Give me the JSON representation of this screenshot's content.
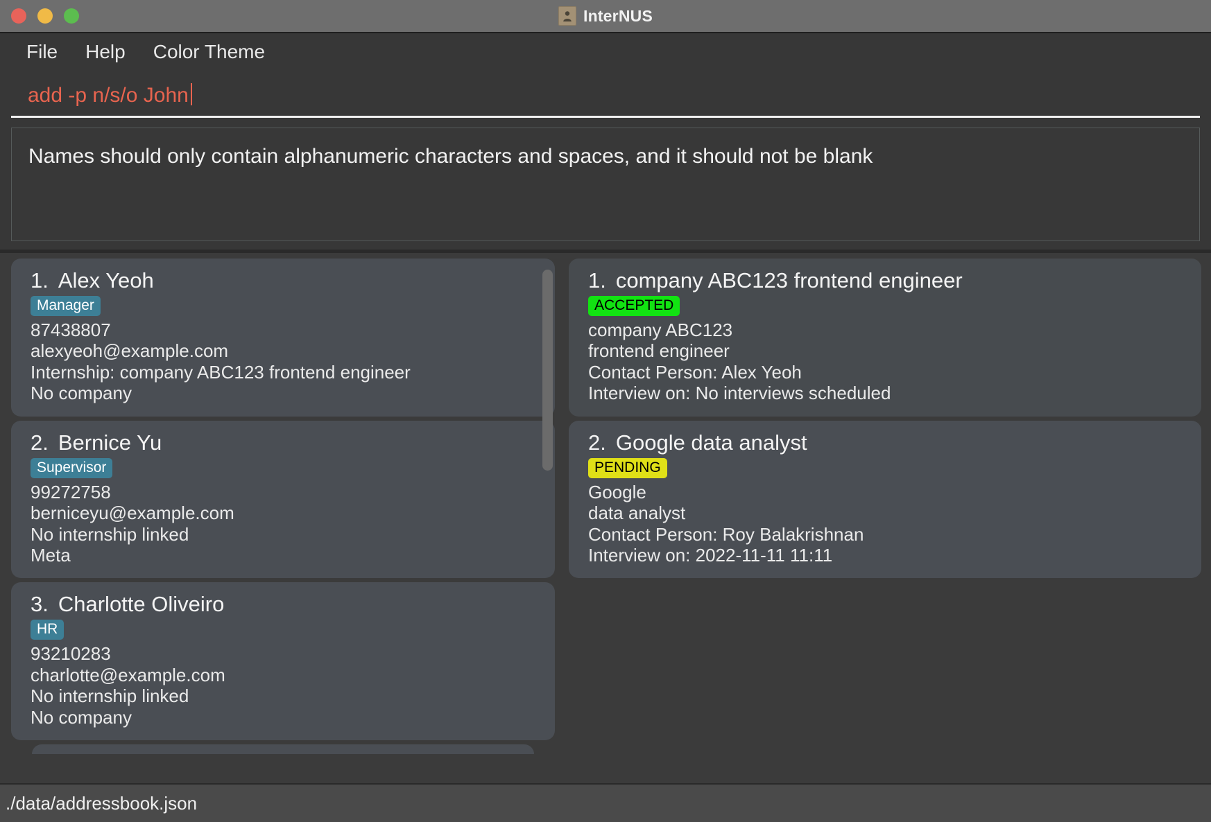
{
  "window": {
    "title": "InterNUS",
    "icon": "address-book-icon",
    "traffic_lights": [
      {
        "name": "close",
        "color": "#e8635a"
      },
      {
        "name": "minimize",
        "color": "#f0ba47"
      },
      {
        "name": "maximize",
        "color": "#5cbd4f"
      }
    ]
  },
  "menubar": {
    "items": [
      {
        "label": "File"
      },
      {
        "label": "Help"
      },
      {
        "label": "Color Theme"
      }
    ]
  },
  "command_input": {
    "value": "add -p n/s/o John",
    "placeholder": "Enter command here...",
    "text_color": "#e8644f"
  },
  "result_display": {
    "message": "Names should only contain alphanumeric characters and spaces, and it should not be blank"
  },
  "person_list": {
    "items": [
      {
        "index": "1.",
        "name": "Alex Yeoh",
        "tag": "Manager",
        "phone": "87438807",
        "email": "alexyeoh@example.com",
        "internship": "Internship: company ABC123 frontend engineer",
        "company": "No company"
      },
      {
        "index": "2.",
        "name": "Bernice Yu",
        "tag": "Supervisor",
        "phone": "99272758",
        "email": "berniceyu@example.com",
        "internship": "No internship linked",
        "company": "Meta"
      },
      {
        "index": "3.",
        "name": "Charlotte Oliveiro",
        "tag": "HR",
        "phone": "93210283",
        "email": "charlotte@example.com",
        "internship": "No internship linked",
        "company": "No company"
      }
    ]
  },
  "internship_list": {
    "items": [
      {
        "index": "1.",
        "title": "company ABC123 frontend engineer",
        "status": "ACCEPTED",
        "status_color": "#12e312",
        "company": "company ABC123",
        "role": "frontend engineer",
        "contact": "Contact Person: Alex Yeoh",
        "interview": "Interview on: No interviews scheduled"
      },
      {
        "index": "2.",
        "title": "Google data analyst",
        "status": "PENDING",
        "status_color": "#e0e017",
        "company": "Google",
        "role": "data analyst",
        "contact": "Contact Person: Roy Balakrishnan",
        "interview": "Interview on: 2022-11-11 11:11"
      }
    ]
  },
  "statusbar": {
    "save_location": "./data/addressbook.json"
  }
}
